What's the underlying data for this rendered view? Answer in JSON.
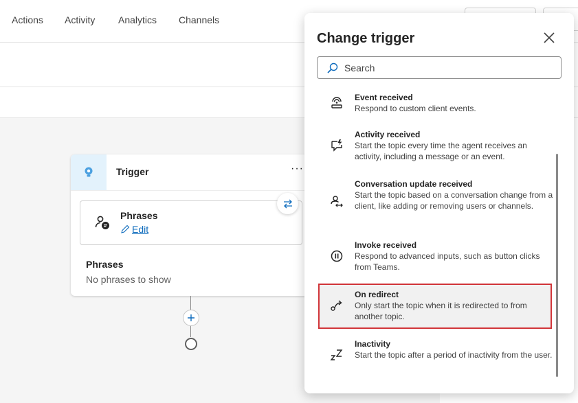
{
  "nav": {
    "items": [
      "Actions",
      "Activity",
      "Analytics",
      "Channels"
    ]
  },
  "trigger": {
    "title": "Trigger",
    "more": "···",
    "phrases_title": "Phrases",
    "edit_label": "Edit",
    "phrases_label": "Phrases",
    "phrases_empty": "No phrases to show"
  },
  "panel": {
    "title": "Change trigger",
    "search_placeholder": "Search",
    "items": [
      {
        "name": "Event received",
        "desc": "Respond to custom client events.",
        "icon": "event-received-icon"
      },
      {
        "name": "Activity received",
        "desc": "Start the topic every time the agent receives an activity, including a message or an event.",
        "icon": "activity-received-icon"
      },
      {
        "name": "Conversation update received",
        "desc": "Start the topic based on a conversation change from a client, like adding or removing users or channels.",
        "icon": "conversation-update-icon"
      },
      {
        "name": "Invoke received",
        "desc": "Respond to advanced inputs, such as button clicks from Teams.",
        "icon": "invoke-received-icon"
      },
      {
        "name": "On redirect",
        "desc": "Only start the topic when it is redirected to from another topic.",
        "icon": "redirect-icon"
      },
      {
        "name": "Inactivity",
        "desc": "Start the topic after a period of inactivity from the user.",
        "icon": "inactivity-icon"
      }
    ]
  },
  "colors": {
    "accent": "#0f6cbd",
    "highlight_border": "#d13438"
  }
}
